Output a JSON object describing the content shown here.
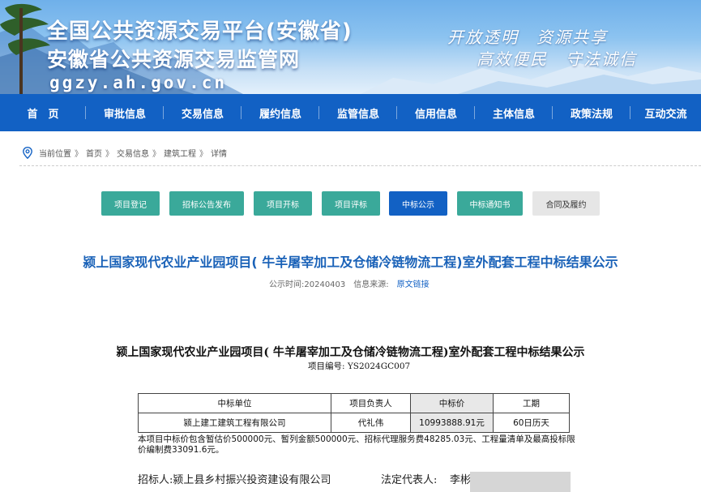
{
  "banner": {
    "title_line1": "全国公共资源交易平台(安徽省)",
    "title_line2": "安徽省公共资源交易监管网",
    "domain": "ggzy.ah.gov.cn",
    "slogans": [
      "开放透明",
      "资源共享",
      "高效便民",
      "守法诚信"
    ]
  },
  "nav": {
    "items": [
      "首　页",
      "审批信息",
      "交易信息",
      "履约信息",
      "监管信息",
      "信用信息",
      "主体信息",
      "政策法规",
      "互动交流"
    ]
  },
  "breadcrumb": {
    "items": [
      "当前位置",
      "首页",
      "交易信息",
      "建筑工程",
      "详情"
    ],
    "separator": "》"
  },
  "steps": {
    "items": [
      "项目登记",
      "招标公告发布",
      "项目开标",
      "项目评标",
      "中标公示",
      "中标通知书",
      "合同及履约"
    ],
    "active_index": 4
  },
  "article": {
    "title": "颍上国家现代农业产业园项目( 牛羊屠宰加工及仓储冷链物流工程)室外配套工程中标结果公示",
    "publish_label": "公示时间:",
    "publish_date": "20240403",
    "source_label": "信息来源:",
    "source_link": "原文链接"
  },
  "document": {
    "title": "颍上国家现代农业产业园项目( 牛羊屠宰加工及仓储冷链物流工程)室外配套工程中标结果公示",
    "project_code": "项目编号: YS2024GC007",
    "table": {
      "headers": [
        "中标单位",
        "项目负责人",
        "中标价",
        "工期"
      ],
      "rows": [
        [
          "颍上建工建筑工程有限公司",
          "代礼伟",
          "10993888.91元",
          "60日历天"
        ]
      ]
    },
    "note": "本项目中标价包含暂估价500000元、暂列金额500000元、招标代理服务费48285.03元、工程量清单及最高投标限价编制费33091.6元。",
    "tenderer_label": "招标人:",
    "tenderer": "颍上县乡村振兴投资建设有限公司",
    "legal_rep_label": "法定代表人:",
    "legal_rep": "李彬"
  },
  "colors": {
    "nav_bg": "#1261c4",
    "step_bg": "#3aa99a",
    "step_active_bg": "#1261c4",
    "title_color": "#1a62b8"
  }
}
